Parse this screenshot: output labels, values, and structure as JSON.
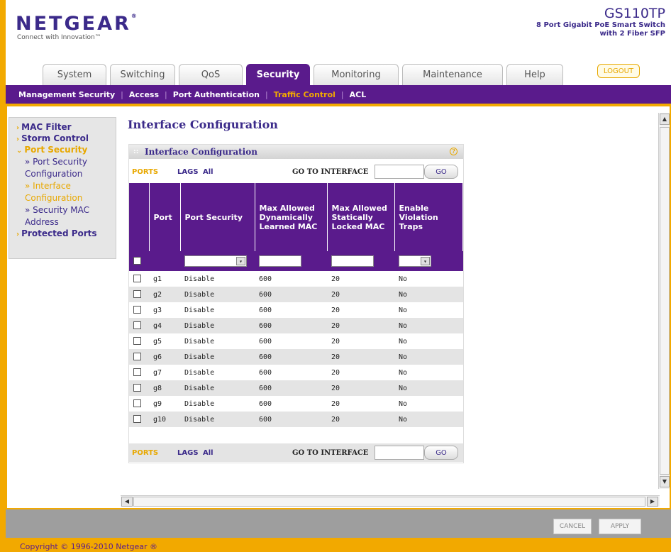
{
  "header": {
    "logo": "NETGEAR",
    "logo_mark": "®",
    "tagline": "Connect with Innovation™",
    "model": "GS110TP",
    "model_desc_1": "8 Port Gigabit PoE Smart Switch",
    "model_desc_2": "with 2 Fiber SFP",
    "logout": "LOGOUT"
  },
  "tabs": [
    {
      "label": "System"
    },
    {
      "label": "Switching"
    },
    {
      "label": "QoS"
    },
    {
      "label": "Security"
    },
    {
      "label": "Monitoring"
    },
    {
      "label": "Maintenance"
    },
    {
      "label": "Help"
    }
  ],
  "subnav": [
    "Management Security",
    "Access",
    "Port Authentication",
    "Traffic Control",
    "ACL"
  ],
  "leftmenu": {
    "mac_filter": "MAC Filter",
    "storm_control": "Storm Control",
    "port_security": "Port Security",
    "sub1": "» Port Security Configuration",
    "sub2": "» Interface Configuration",
    "sub3": "» Security MAC Address",
    "protected_ports": "Protected Ports"
  },
  "page_title": "Interface Configuration",
  "box_title": "Interface Configuration",
  "help_icon": "?",
  "filterbar": {
    "ports": "PORTS",
    "lags": "LAGS",
    "all": "All",
    "goto": "GO TO INTERFACE",
    "go": "GO"
  },
  "columns": [
    "Port",
    "Port Security",
    "Max Allowed Dynamically Learned MAC",
    "Max Allowed Statically Locked MAC",
    "Enable Violation Traps"
  ],
  "rows": [
    {
      "port": "g1",
      "security": "Disable",
      "dyn": "600",
      "stat": "20",
      "traps": "No"
    },
    {
      "port": "g2",
      "security": "Disable",
      "dyn": "600",
      "stat": "20",
      "traps": "No"
    },
    {
      "port": "g3",
      "security": "Disable",
      "dyn": "600",
      "stat": "20",
      "traps": "No"
    },
    {
      "port": "g4",
      "security": "Disable",
      "dyn": "600",
      "stat": "20",
      "traps": "No"
    },
    {
      "port": "g5",
      "security": "Disable",
      "dyn": "600",
      "stat": "20",
      "traps": "No"
    },
    {
      "port": "g6",
      "security": "Disable",
      "dyn": "600",
      "stat": "20",
      "traps": "No"
    },
    {
      "port": "g7",
      "security": "Disable",
      "dyn": "600",
      "stat": "20",
      "traps": "No"
    },
    {
      "port": "g8",
      "security": "Disable",
      "dyn": "600",
      "stat": "20",
      "traps": "No"
    },
    {
      "port": "g9",
      "security": "Disable",
      "dyn": "600",
      "stat": "20",
      "traps": "No"
    },
    {
      "port": "g10",
      "security": "Disable",
      "dyn": "600",
      "stat": "20",
      "traps": "No"
    }
  ],
  "buttons": {
    "cancel": "CANCEL",
    "apply": "APPLY"
  },
  "copyright": "Copyright © 1996-2010 Netgear ®",
  "colors": {
    "purple": "#5a1b8c",
    "orange": "#f2a900"
  }
}
